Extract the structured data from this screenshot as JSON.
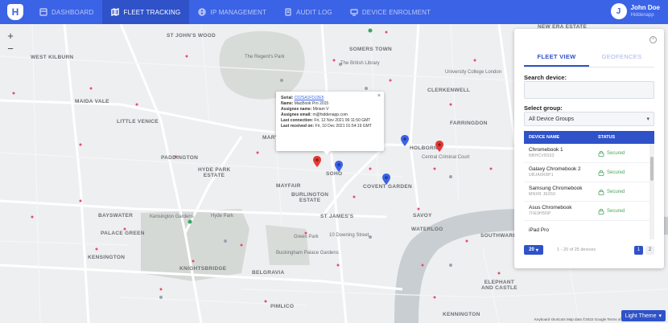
{
  "app": {
    "logo_letter": "H"
  },
  "nav": [
    {
      "label": "DASHBOARD",
      "icon": "dashboard-icon",
      "active": false
    },
    {
      "label": "FLEET TRACKING",
      "icon": "map-icon",
      "active": true
    },
    {
      "label": "IP MANAGEMENT",
      "icon": "network-icon",
      "active": false
    },
    {
      "label": "AUDIT LOG",
      "icon": "log-icon",
      "active": false
    },
    {
      "label": "DEVICE ENROLMENT",
      "icon": "device-icon",
      "active": false
    }
  ],
  "user": {
    "initial": "J",
    "name": "John Doe",
    "org": "Hiddenapp"
  },
  "map": {
    "zoom_in": "+",
    "zoom_out": "−",
    "attribution": "Keyboard shortcuts   Map data ©2022 Google   Terms of Use   Report a map error",
    "labels": [
      {
        "text": "ST JOHN'S\nWOOD"
      },
      {
        "text": "WEST KILBURN"
      },
      {
        "text": "MAIDA VALE"
      },
      {
        "text": "LITTLE VENICE"
      },
      {
        "text": "PADDINGTON"
      },
      {
        "text": "HYDE PARK\nESTATE"
      },
      {
        "text": "MARYLEBONE"
      },
      {
        "text": "BAYSWATER"
      },
      {
        "text": "MAYFAIR"
      },
      {
        "text": "BURLINGTON\nESTATE"
      },
      {
        "text": "SOHO"
      },
      {
        "text": "COVENT GARDEN"
      },
      {
        "text": "ST JAMES'S"
      },
      {
        "text": "PALACE GREEN"
      },
      {
        "text": "KENSINGTON"
      },
      {
        "text": "KNIGHTSBRIDGE"
      },
      {
        "text": "BELGRAVIA"
      },
      {
        "text": "HOLBORN"
      },
      {
        "text": "FARRINGDON"
      },
      {
        "text": "CLERKENWELL"
      },
      {
        "text": "WATERLOO"
      },
      {
        "text": "KENNINGTON"
      },
      {
        "text": "SOUTHWARK"
      },
      {
        "text": "SOMERS TOWN"
      },
      {
        "text": "NEW ERA ESTATE"
      },
      {
        "text": "PIMLICO"
      },
      {
        "text": "ELEPHANT\nAND CASTLE"
      },
      {
        "text": "SAVOY"
      }
    ],
    "places": [
      {
        "text": "The Regent's Park"
      },
      {
        "text": "The British Library"
      },
      {
        "text": "Hyde Park"
      },
      {
        "text": "Kensington Gardens"
      },
      {
        "text": "Green Park"
      },
      {
        "text": "Buckingham Palace Gardens"
      },
      {
        "text": "10 Downing Street"
      },
      {
        "text": "Central Criminal Court"
      },
      {
        "text": "University College London"
      }
    ]
  },
  "popup": {
    "serial_label": "Serial:",
    "serial_value": "C02SA1FDJ2E5",
    "name_label": "Name:",
    "name_value": "MacBook Pro 2015",
    "assignee_label": "Assignee name:",
    "assignee_value": "Miriam V",
    "email_label": "Assignee email:",
    "email_value": "m@hiddenapp.com",
    "conn_label": "Last connection:",
    "conn_value": "Fri, 12 Nov 2021 06:11:50 GMT",
    "recv_label": "Last received on:",
    "recv_value": "Fri, 10 Dec 2021 01:54:19 GMT",
    "close": "×"
  },
  "panel": {
    "close": "×",
    "tabs": [
      {
        "label": "FLEET VIEW",
        "active": true
      },
      {
        "label": "GEOFENCES",
        "active": false
      }
    ],
    "search_label": "Search device:",
    "search_value": "",
    "group_label": "Select group:",
    "group_value": "All Device Groups",
    "columns": {
      "name": "DEVICE NAME",
      "status": "STATUS"
    },
    "devices": [
      {
        "name": "Chromebook 1",
        "serial": "NBHCV8S53",
        "status": "Secured"
      },
      {
        "name": "Galaxy Chromebook 2",
        "serial": "UBJA6R8P1",
        "status": "Secured"
      },
      {
        "name": "Samsung Chromebook",
        "serial": "MNXR JE650",
        "status": "Secured"
      },
      {
        "name": "Asus Chromebook",
        "serial": "7IIE9H5NP",
        "status": "Secured"
      },
      {
        "name": "iPad Pro",
        "serial": "",
        "status": ""
      }
    ],
    "per_page": "20",
    "range": "1 - 20 of 25 devices",
    "pages": [
      {
        "label": "1",
        "active": true
      },
      {
        "label": "2",
        "active": false
      }
    ]
  },
  "theme_button": "Light Theme",
  "colors": {
    "brand": "#3b63e6",
    "brand_dark": "#2f52c9",
    "secured": "#4aa35b",
    "pin_red": "#e53935",
    "pin_blue": "#3b63e6"
  }
}
